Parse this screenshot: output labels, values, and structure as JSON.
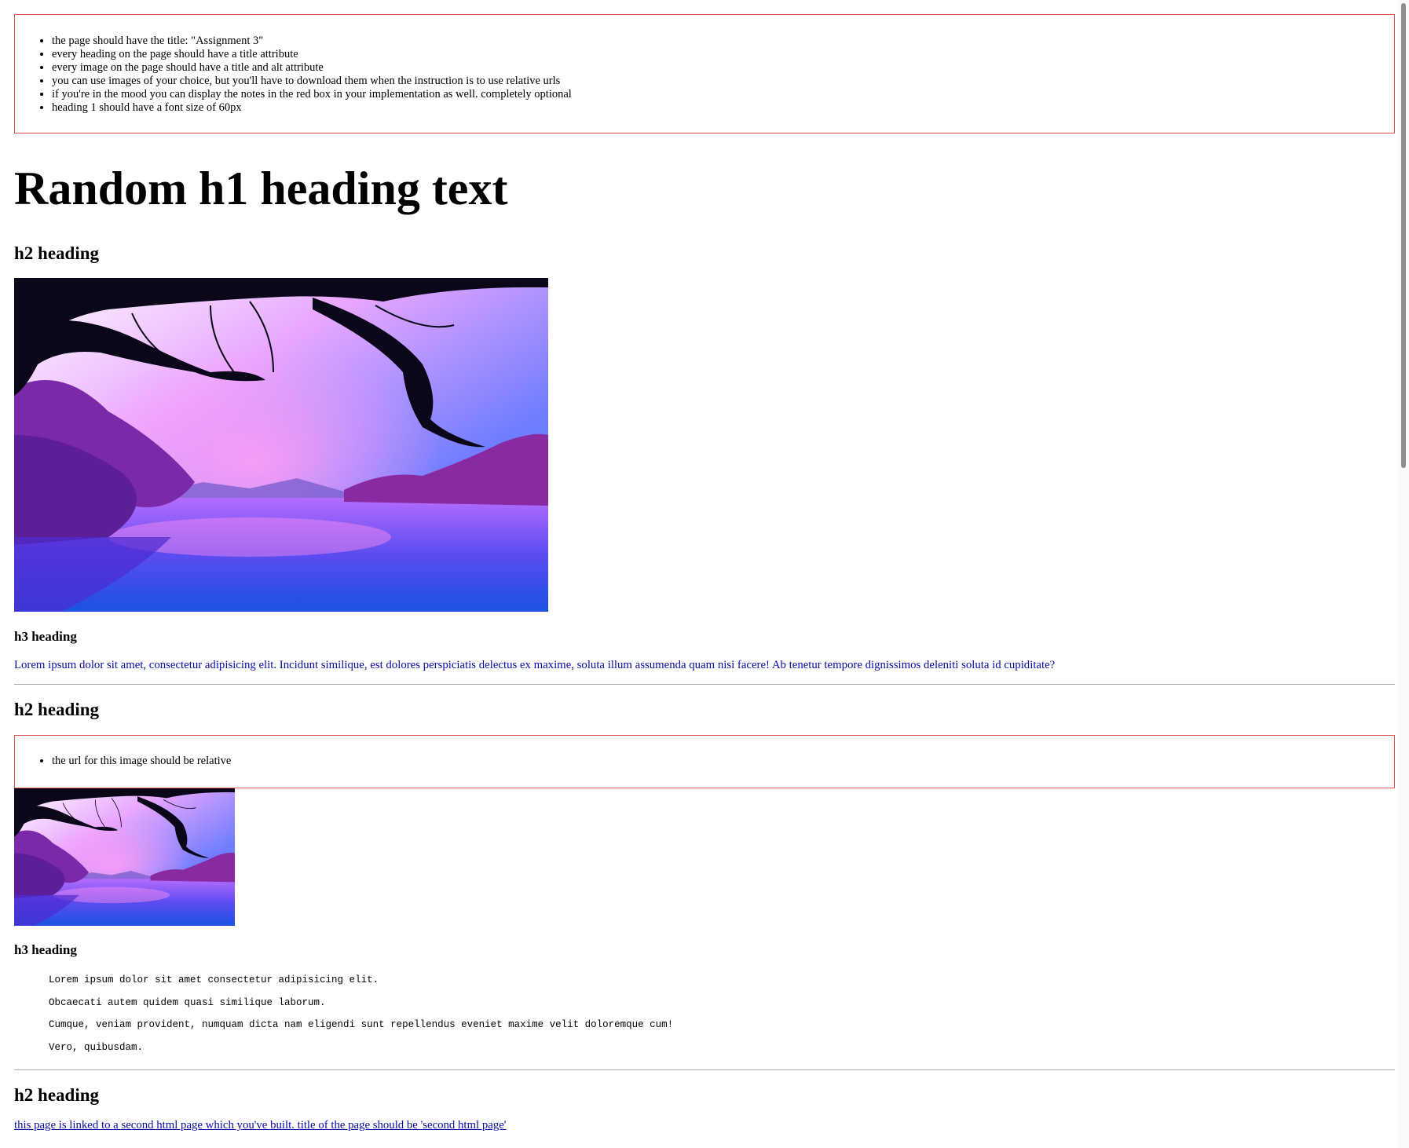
{
  "notes_top": [
    "the page should have the title: \"Assignment 3\"",
    "every heading on the page should have a title attribute",
    "every image on the page should have a title and alt attribute",
    "you can use images of your choice, but you'll have to download them when the instruction is to use relative urls",
    "if you're in the mood you can display the notes in the red box in your implementation as well. completely optional",
    "heading 1 should have a font size of 60px"
  ],
  "h1": "Random h1 heading text",
  "section1": {
    "h2": "h2 heading",
    "h3": "h3 heading",
    "paragraph": "Lorem ipsum dolor sit amet, consectetur adipisicing elit. Incidunt similique, est dolores perspiciatis delectus ex maxime, soluta illum assumenda quam nisi facere! Ab tenetur tempore dignissimos deleniti soluta id cupiditate?"
  },
  "section2": {
    "h2": "h2 heading",
    "note": "the url for this image should be relative",
    "h3": "h3 heading",
    "pre_lines": [
      "Lorem ipsum dolor sit amet consectetur adipisicing elit.",
      "Obcaecati autem quidem quasi similique laborum.",
      "Cumque, veniam provident, numquam dicta nam eligendi sunt repellendus eveniet maxime velit doloremque cum!",
      "Vero, quibusdam."
    ]
  },
  "section3": {
    "h2": "h2 heading",
    "link": "this page is linked to a second html page which you've built. title of the page should be 'second html page'"
  },
  "colors": {
    "note_border": "#d9534f",
    "link": "#0a0aa8"
  }
}
